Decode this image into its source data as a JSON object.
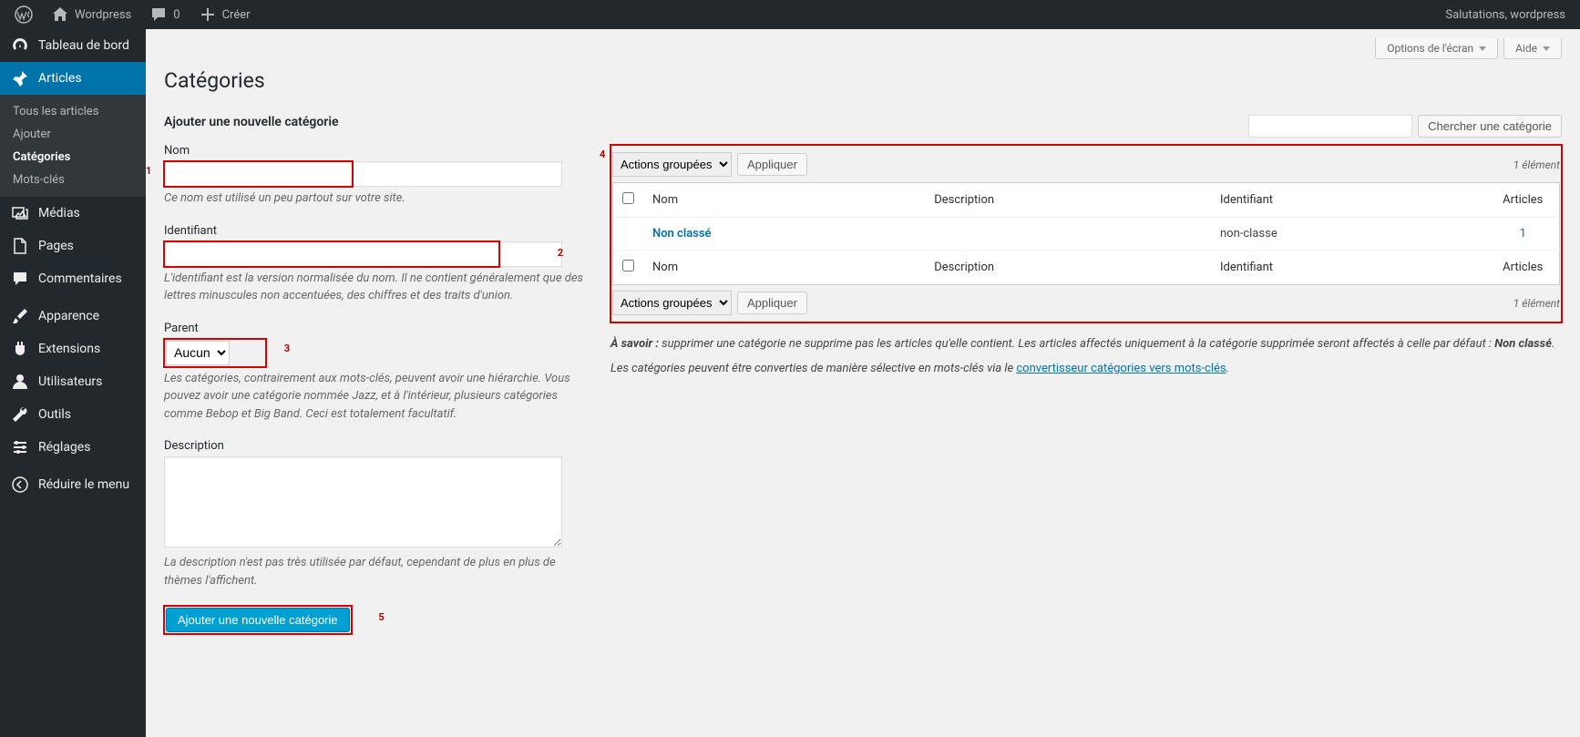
{
  "adminbar": {
    "site_name": "Wordpress",
    "comments_count": "0",
    "new_label": "Créer",
    "greeting": "Salutations, wordpress"
  },
  "menu": {
    "dashboard": "Tableau de bord",
    "posts": "Articles",
    "sub_posts": {
      "all": "Tous les articles",
      "add": "Ajouter",
      "categories": "Catégories",
      "tags": "Mots-clés"
    },
    "media": "Médias",
    "pages": "Pages",
    "comments": "Commentaires",
    "appearance": "Apparence",
    "plugins": "Extensions",
    "users": "Utilisateurs",
    "tools": "Outils",
    "settings": "Réglages",
    "collapse": "Réduire le menu"
  },
  "top_buttons": {
    "screen_options": "Options de l'écran",
    "help": "Aide"
  },
  "page_title": "Catégories",
  "form": {
    "heading": "Ajouter une nouvelle catégorie",
    "name_label": "Nom",
    "name_help": "Ce nom est utilisé un peu partout sur votre site.",
    "slug_label": "Identifiant",
    "slug_help": "L'identifiant est la version normalisée du nom. Il ne contient généralement que des lettres minuscules non accentuées, des chiffres et des traits d'union.",
    "parent_label": "Parent",
    "parent_value": "Aucun",
    "parent_help": "Les catégories, contrairement aux mots-clés, peuvent avoir une hiérarchie. Vous pouvez avoir une catégorie nommée Jazz, et à l'intérieur, plusieurs catégories comme Bebop et Big Band. Ceci est totalement facultatif.",
    "desc_label": "Description",
    "desc_help": "La description n'est pas très utilisée par défaut, cependant de plus en plus de thèmes l'affichent.",
    "submit": "Ajouter une nouvelle catégorie"
  },
  "search": {
    "button": "Chercher une catégorie"
  },
  "bulk": {
    "action_label": "Actions groupées",
    "apply": "Appliquer",
    "count": "1 élément"
  },
  "table": {
    "headers": {
      "name": "Nom",
      "desc": "Description",
      "slug": "Identifiant",
      "posts": "Articles"
    },
    "rows": [
      {
        "name": "Non classé",
        "desc": "",
        "slug": "non-classe",
        "posts": "1"
      }
    ]
  },
  "notes": {
    "line1_prefix": "À savoir :",
    "line1_body": " supprimer une catégorie ne supprime pas les articles qu'elle contient. Les articles affectés uniquement à la catégorie supprimée seront affectés à celle par défaut  : ",
    "line1_default": "Non classé",
    "line2_prefix": "Les catégories peuvent être converties de manière sélective en mots-clés via le ",
    "line2_link": "convertisseur catégories vers mots-clés"
  },
  "annotations": {
    "n1": "1",
    "n2": "2",
    "n3": "3",
    "n4": "4",
    "n5": "5"
  }
}
